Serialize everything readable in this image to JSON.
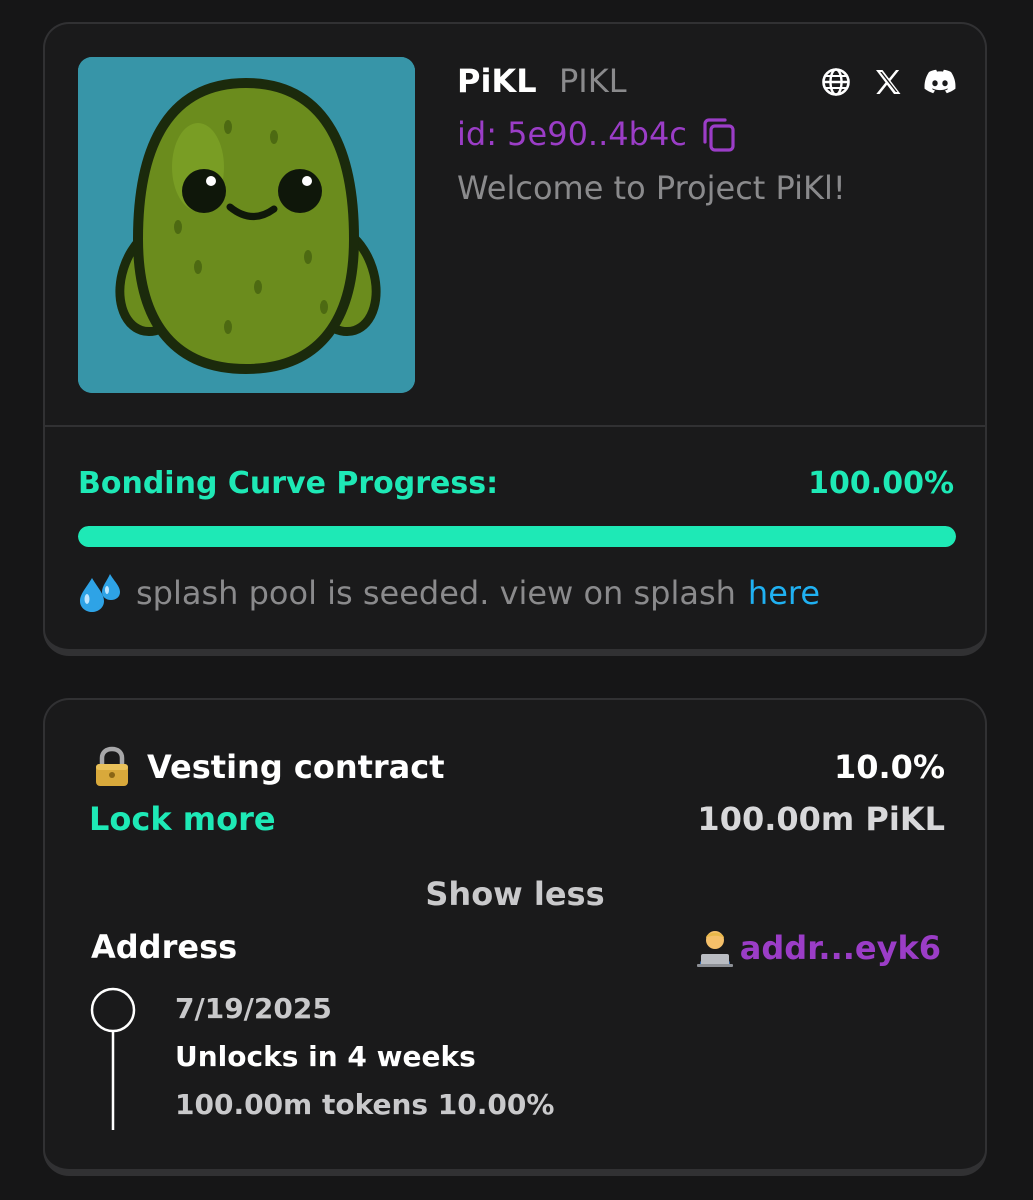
{
  "token": {
    "name": "PiKL",
    "ticker": "PIKL",
    "id": "id: 5e90..4b4c",
    "description": "Welcome to Project PiKl!",
    "image_icon": "pickle-mascot-image"
  },
  "socials": [
    {
      "icon": "globe-icon"
    },
    {
      "icon": "x-icon"
    },
    {
      "icon": "discord-icon"
    }
  ],
  "bonding": {
    "label": "Bonding Curve Progress:",
    "value_text": "100.00%",
    "progress": 1.0,
    "color": "#1ee9b6"
  },
  "splash": {
    "emoji_icon": "sweat-droplets-icon",
    "text": "splash pool is seeded. view on splash",
    "link_label": "here",
    "link_color": "#20b1f2"
  },
  "vesting": {
    "lock_icon": "lock-icon",
    "title": "Vesting contract",
    "percent": "10.0%",
    "lock_more_label": "Lock more",
    "amount": "100.00m PiKL",
    "toggle_label": "Show less",
    "address_label": "Address",
    "address_emoji_icon": "technologist-icon",
    "address_value": "addr...eyk6",
    "schedule": [
      {
        "date": "7/19/2025",
        "status": "Unlocks in 4 weeks",
        "amount": "100.00m tokens 10.00%"
      }
    ]
  },
  "colors": {
    "background": "#161617",
    "card": "#1a1a1b",
    "accent_green": "#1ee9b6",
    "accent_purple": "#9b3dc7"
  }
}
